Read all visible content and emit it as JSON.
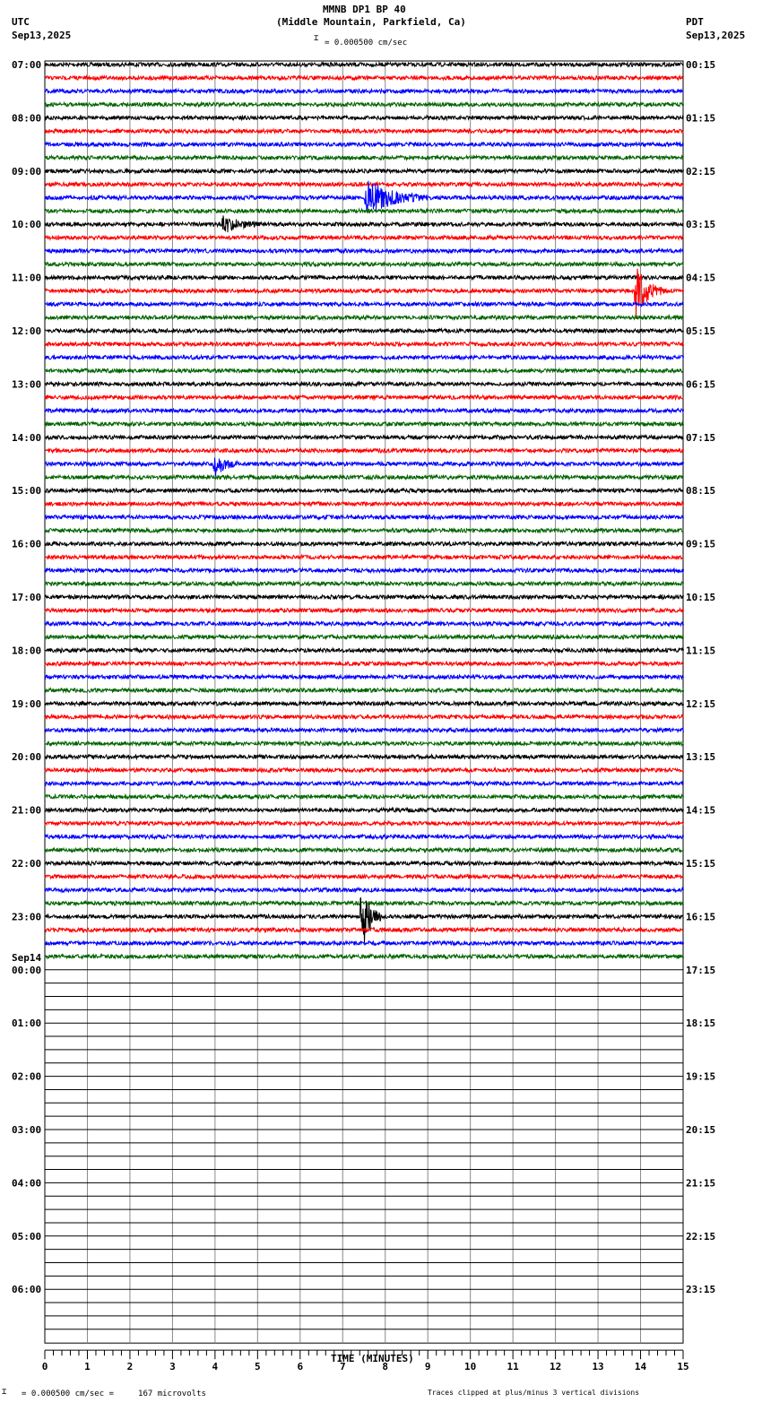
{
  "header": {
    "title": "MMNB DP1 BP 40",
    "subtitle": "(Middle Mountain, Parkfield, Ca)",
    "left_tz": "UTC",
    "left_date": "Sep13,2025",
    "right_tz": "PDT",
    "right_date": "Sep13,2025",
    "scale": "= 0.000500 cm/sec"
  },
  "footer": {
    "scale": "= 0.000500 cm/sec =     167 microvolts",
    "clip_note": "Traces clipped at plus/minus 3 vertical divisions"
  },
  "chart_data": {
    "type": "line",
    "title": "MMNB DP1 BP 40",
    "xlabel": "TIME (MINUTES)",
    "xlim": [
      0,
      15
    ],
    "x_ticks": [
      "0",
      "1",
      "2",
      "3",
      "4",
      "5",
      "6",
      "7",
      "8",
      "9",
      "10",
      "11",
      "12",
      "13",
      "14",
      "15"
    ],
    "rows_total": 96,
    "rows_with_data": 68,
    "row_minutes": 15,
    "trace_colors": [
      "#000000",
      "#ff0000",
      "#0000ff",
      "#006400"
    ],
    "left_labels": [
      "07:00",
      "08:00",
      "09:00",
      "10:00",
      "11:00",
      "12:00",
      "13:00",
      "14:00",
      "15:00",
      "16:00",
      "17:00",
      "18:00",
      "19:00",
      "20:00",
      "21:00",
      "22:00",
      "23:00",
      "00:00",
      "01:00",
      "02:00",
      "03:00",
      "04:00",
      "05:00",
      "06:00"
    ],
    "day_change_label": "Sep14",
    "right_labels": [
      "00:15",
      "01:15",
      "02:15",
      "03:15",
      "04:15",
      "05:15",
      "06:15",
      "07:15",
      "08:15",
      "09:15",
      "10:15",
      "11:15",
      "12:15",
      "13:15",
      "14:15",
      "15:15",
      "16:15",
      "17:15",
      "18:15",
      "19:15",
      "20:15",
      "21:15",
      "22:15",
      "23:15"
    ],
    "events": [
      {
        "row": 10,
        "start_min": 7.5,
        "duration_min": 1.5,
        "amplitude": 1.6
      },
      {
        "row": 12,
        "start_min": 4.15,
        "duration_min": 0.9,
        "amplitude": 0.8
      },
      {
        "row": 17,
        "start_min": 13.85,
        "duration_min": 0.7,
        "amplitude": 2.6
      },
      {
        "row": 30,
        "start_min": 3.95,
        "duration_min": 0.6,
        "amplitude": 1.2
      },
      {
        "row": 64,
        "start_min": 7.4,
        "duration_min": 0.5,
        "amplitude": 3.5
      }
    ]
  }
}
